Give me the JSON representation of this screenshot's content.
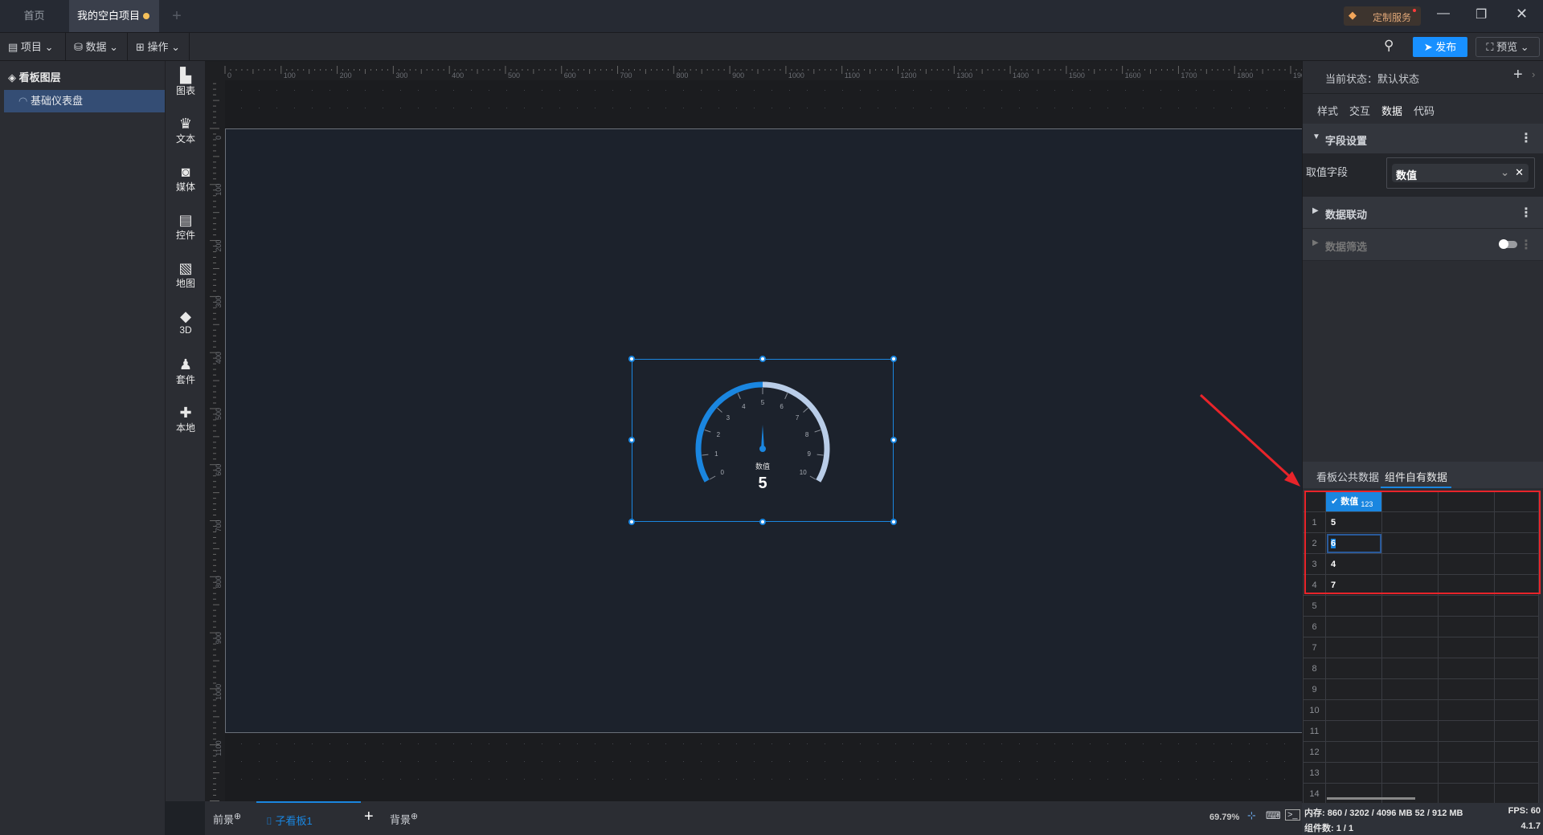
{
  "titlebar": {
    "tabs": [
      {
        "label": "首页"
      },
      {
        "label": "我的空白项目",
        "modified": true
      }
    ],
    "add_tab": "+",
    "custom_service": "定制服务",
    "colors": {
      "dot": "#f5c05a",
      "accent": "#1890ff"
    }
  },
  "toolbar": {
    "menus": [
      {
        "label": "项目",
        "icon": "file-icon"
      },
      {
        "label": "数据",
        "icon": "database-icon"
      },
      {
        "label": "操作",
        "icon": "grid-icon"
      }
    ],
    "publish": "发布",
    "preview": "预览"
  },
  "layers": {
    "title": "看板图层",
    "items": [
      {
        "label": "基础仪表盘",
        "selected": true
      }
    ]
  },
  "components": [
    {
      "label": "图表",
      "icon": "bar-chart-icon"
    },
    {
      "label": "文本",
      "icon": "crown-icon"
    },
    {
      "label": "媒体",
      "icon": "camera-icon"
    },
    {
      "label": "控件",
      "icon": "list-icon"
    },
    {
      "label": "地图",
      "icon": "map-icon"
    },
    {
      "label": "3D",
      "icon": "cube-icon"
    },
    {
      "label": "套件",
      "icon": "shirt-icon"
    },
    {
      "label": "本地",
      "icon": "puzzle-icon"
    }
  ],
  "ruler": {
    "h": [
      "0",
      "100",
      "200",
      "300",
      "400",
      "500",
      "600",
      "700",
      "800",
      "900",
      "1000",
      "1100",
      "1200",
      "1300",
      "1400",
      "1500",
      "1600",
      "1700",
      "1800",
      "1900"
    ],
    "v": [
      "0",
      "100",
      "200",
      "300",
      "400",
      "500",
      "600",
      "700",
      "800",
      "900",
      "1000",
      "1100"
    ]
  },
  "gauge": {
    "label": "数值",
    "value": 5,
    "min": 0,
    "max": 10,
    "ticks": [
      "0",
      "1",
      "2",
      "3",
      "4",
      "5",
      "6",
      "7",
      "8",
      "9",
      "10"
    ],
    "colors": {
      "progress": "#1a86e0",
      "rest": "#b9cde8"
    }
  },
  "bottombar": {
    "foreground": "前景",
    "subboard": "子看板1",
    "add": "+",
    "background": "背景",
    "zoom": "69.79%"
  },
  "rightpanel": {
    "state_label": "当前状态：",
    "state_value": "默认状态",
    "tabs": [
      "样式",
      "交互",
      "数据",
      "代码"
    ],
    "active_tab": "数据",
    "field_section": "字段设置",
    "field_label": "取值字段",
    "field_value": "数值",
    "linkage": "数据联动",
    "filter": "数据筛选",
    "filter_enabled": false,
    "data_tabs": [
      "看板公共数据",
      "组件自有数据"
    ],
    "active_data_tab": "组件自有数据",
    "table": {
      "column": "数值",
      "column_type": "123",
      "values": [
        "5",
        "6",
        "4",
        "7"
      ],
      "editing_row": 2,
      "row_numbers": [
        "1",
        "2",
        "3",
        "4",
        "5",
        "6",
        "7",
        "8",
        "9",
        "10",
        "11",
        "12",
        "13",
        "14"
      ]
    }
  },
  "status": {
    "memory": "内存:  860 / 3202 / 4096 MB  52 / 912 MB",
    "fps": "FPS:  60",
    "count": "组件数: 1 / 1",
    "version": "4.1.7"
  }
}
